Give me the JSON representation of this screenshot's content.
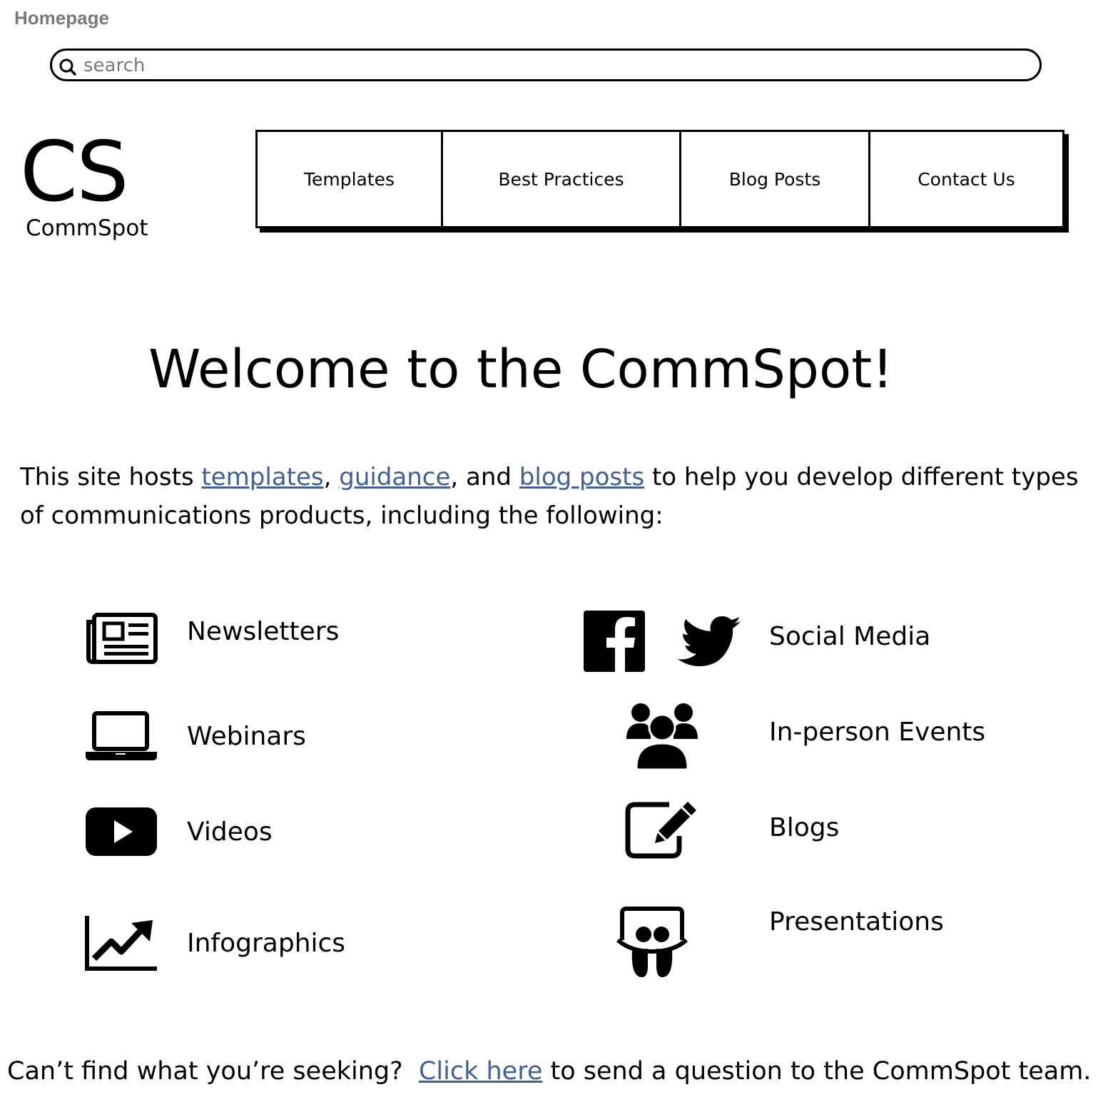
{
  "page": {
    "label": "Homepage"
  },
  "search": {
    "placeholder": "search",
    "value": ""
  },
  "logo": {
    "mark": "CS",
    "name": "CommSpot"
  },
  "nav": {
    "items": [
      {
        "label": "Templates"
      },
      {
        "label": "Best Practices"
      },
      {
        "label": "Blog Posts"
      },
      {
        "label": "Contact Us"
      }
    ]
  },
  "welcome": {
    "heading": "Welcome to the CommSpot!"
  },
  "intro": {
    "prefix": "This site hosts ",
    "link_templates": "templates",
    "sep1": ", ",
    "link_guidance": "guidance",
    "sep2": ", and ",
    "link_blog_posts": "blog posts",
    "suffix": " to help you develop different types of communications products, including the following:"
  },
  "products": {
    "newsletters": {
      "label": "Newsletters",
      "icon": "newspaper-icon"
    },
    "webinars": {
      "label": "Webinars",
      "icon": "laptop-icon"
    },
    "videos": {
      "label": "Videos",
      "icon": "youtube-play-icon"
    },
    "infographics": {
      "label": "Infographics",
      "icon": "line-chart-icon"
    },
    "social_media": {
      "label": "Social Media",
      "icons": [
        "facebook-icon",
        "twitter-icon"
      ]
    },
    "in_person_events": {
      "label": "In-person Events",
      "icon": "group-icon"
    },
    "blogs": {
      "label": "Blogs",
      "icon": "edit-icon"
    },
    "presentations": {
      "label": "Presentations",
      "icon": "slideshare-icon"
    }
  },
  "cta": {
    "prefix": "Can’t find what you’re seeking?  ",
    "link": "Click here",
    "suffix": " to send a question to the CommSpot team."
  },
  "colors": {
    "link": "#3f5f96",
    "page_label": "#7a7a7a"
  }
}
